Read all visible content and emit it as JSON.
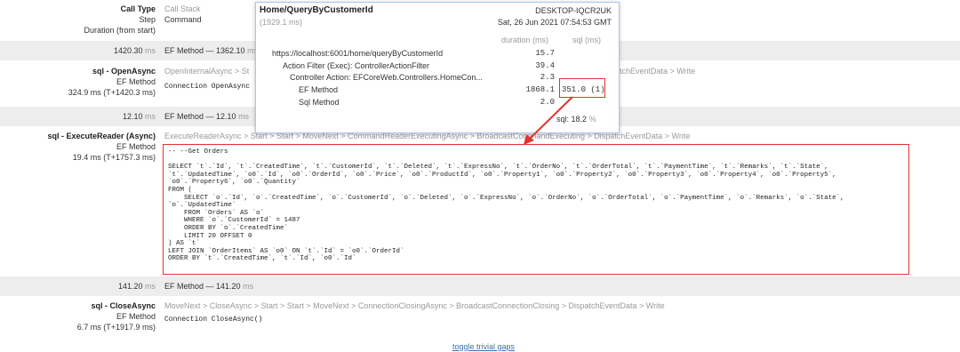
{
  "header": {
    "call_type_label": "Call Type",
    "call_type_value": "Call Stack",
    "step_label": "Step",
    "step_value": "Command",
    "duration_label": "Duration (from start)"
  },
  "rows": [
    {
      "time": "1420.30",
      "unit": "ms",
      "method": "EF Method — 1362.10",
      "method_unit": "ms"
    },
    {
      "time": "12.10",
      "unit": "ms",
      "method": "EF Method — 12.10",
      "method_unit": "ms"
    },
    {
      "time": "141.20",
      "unit": "ms",
      "method": "EF Method — 141.20",
      "method_unit": "ms"
    }
  ],
  "open_async": {
    "title": "sql - OpenAsync",
    "sub": "EF Method",
    "timing": "324.9 ms (T+1420.3 ms)",
    "stack": "OpenInternalAsync > St",
    "stack_tail": "tchEventData > Write",
    "command": "Connection OpenAsync"
  },
  "execute_reader": {
    "title": "sql - ExecuteReader (Async)",
    "sub": "EF Method",
    "timing": "19.4 ms (T+1757.3 ms)",
    "stack": "ExecuteReaderAsync > Start > Start > MoveNext > CommandReaderExecutingAsync > BroadcastCommandExecuting > DispatchEventData > Write",
    "sql_lines": [
      "-- --Get Orders",
      "",
      "SELECT `t`.`Id`, `t`.`CreatedTime`, `t`.`CustomerId`, `t`.`Deleted`, `t`.`ExpressNo`, `t`.`OrderNo`, `t`.`OrderTotal`, `t`.`PaymentTime`, `t`.`Remarks`, `t`.`State`,",
      "`t`.`UpdatedTime`, `o0`.`Id`, `o0`.`OrderId`, `o0`.`Price`, `o0`.`ProductId`, `o0`.`Property1`, `o0`.`Property2`, `o0`.`Property3`, `o0`.`Property4`, `o0`.`Property5`,",
      "`o0`.`Property6`, `o0`.`Quantity`",
      "FROM (",
      "    SELECT `o`.`Id`, `o`.`CreatedTime`, `o`.`CustomerId`, `o`.`Deleted`, `o`.`ExpressNo`, `o`.`OrderNo`, `o`.`OrderTotal`, `o`.`PaymentTime`, `o`.`Remarks`, `o`.`State`,",
      "`o`.`UpdatedTime`",
      "    FROM `Orders` AS `o`",
      "    WHERE `o`.`CustomerId` = 1487",
      "    ORDER BY `o`.`CreatedTime`",
      "    LIMIT 20 OFFSET 0",
      ") AS `t`",
      "LEFT JOIN `OrderItems` AS `o0` ON `t`.`Id` = `o0`.`OrderId`",
      "ORDER BY `t`.`CreatedTime`, `t`.`Id`, `o0`.`Id`"
    ]
  },
  "close_async": {
    "title": "sql - CloseAsync",
    "sub": "EF Method",
    "timing": "6.7 ms (T+1917.9 ms)",
    "stack": "MoveNext > CloseAsync > Start > Start > MoveNext > ConnectionClosingAsync > BroadcastConnectionClosing > DispatchEventData > Write",
    "command": "Connection CloseAsync()"
  },
  "footer": {
    "link": "toggle trivial gaps"
  },
  "popup": {
    "title": "Home/QueryByCustomerId",
    "machine": "DESKTOP-IQCR2UK",
    "total": "(1929.1 ms)",
    "date": "Sat, 26 Jun 2021 07:54:53 GMT",
    "col_duration": "duration (ms)",
    "col_sql": "sql (ms)",
    "rows": [
      {
        "name": "https://localhost:6001/home/queryByCustomerId",
        "duration": "15.7",
        "sql": ""
      },
      {
        "name": "Action Filter (Exec): ControllerActionFilter",
        "duration": "39.4",
        "sql": ""
      },
      {
        "name": "Controller Action: EFCoreWeb.Controllers.HomeCon...",
        "duration": "2.3",
        "sql": ""
      },
      {
        "name": "EF Method",
        "duration": "1868.1",
        "sql": "351.0 (1)"
      },
      {
        "name": "Sql Method",
        "duration": "2.0",
        "sql": ""
      }
    ],
    "sql_pct_label": "sql:",
    "sql_pct_value": "18.2",
    "sql_pct_unit": "%"
  },
  "colors": {
    "highlight": "#e0342c",
    "band": "#ededed",
    "popup_border": "#a9c7e8"
  }
}
